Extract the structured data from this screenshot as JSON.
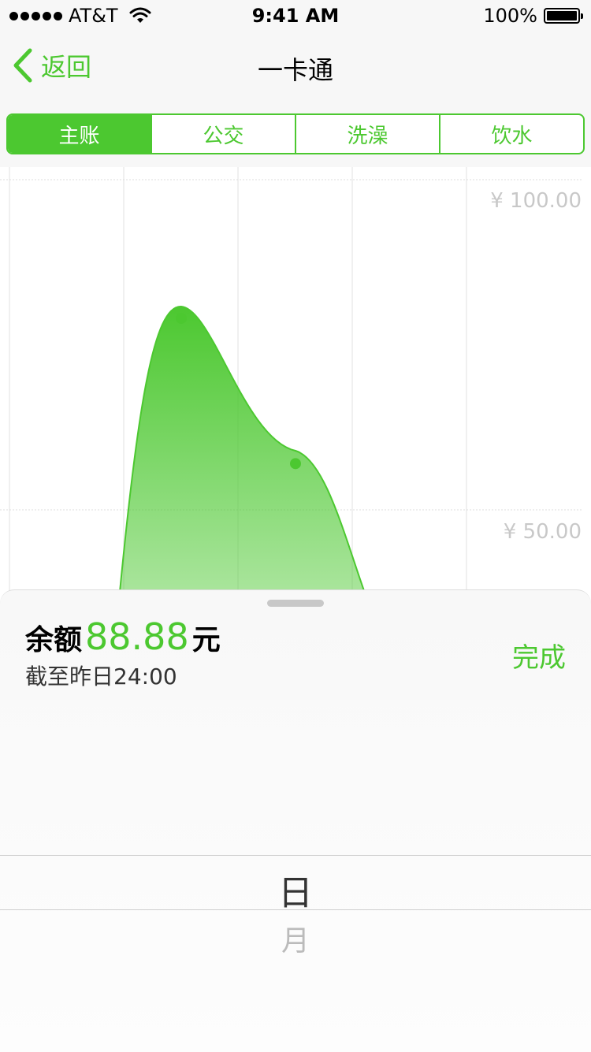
{
  "status_bar": {
    "carrier": "AT&T",
    "time": "9:41 AM",
    "battery": "100%"
  },
  "nav": {
    "back_label": "返回",
    "title": "一卡通"
  },
  "tabs": [
    {
      "label": "主账",
      "active": true
    },
    {
      "label": "公交",
      "active": false
    },
    {
      "label": "洗澡",
      "active": false
    },
    {
      "label": "饮水",
      "active": false
    }
  ],
  "chart_data": {
    "type": "area",
    "y_tick_labels": [
      "¥ 100.00",
      "¥ 50.00"
    ],
    "grid": true,
    "color": "#4cc830",
    "highlighted_points": [
      {
        "y": 79
      },
      {
        "y": 57
      }
    ]
  },
  "sheet": {
    "balance_label": "余额",
    "balance_value": "88.88",
    "balance_unit": "元",
    "note": "截至昨日24:00",
    "done_label": "完成"
  },
  "picker": {
    "options": [
      "日",
      "月"
    ],
    "selected": "日"
  },
  "colors": {
    "accent": "#4cc830",
    "background": "#f7f7f7"
  }
}
